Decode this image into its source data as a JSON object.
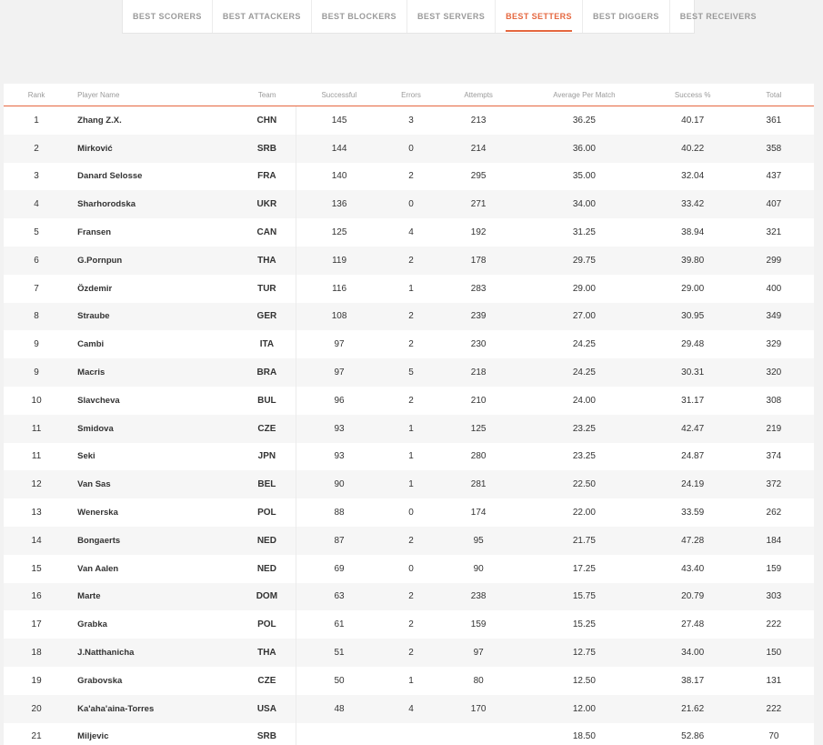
{
  "tabs": [
    {
      "label": "BEST SCORERS",
      "active": false
    },
    {
      "label": "BEST ATTACKERS",
      "active": false
    },
    {
      "label": "BEST BLOCKERS",
      "active": false
    },
    {
      "label": "BEST SERVERS",
      "active": false
    },
    {
      "label": "BEST SETTERS",
      "active": true
    },
    {
      "label": "BEST DIGGERS",
      "active": false
    },
    {
      "label": "BEST RECEIVERS",
      "active": false
    }
  ],
  "colors": {
    "accent": "#e5673f",
    "muted": "#9a9a9a",
    "row_alt": "#f6f6f6"
  },
  "table": {
    "columns": [
      "Rank",
      "Player Name",
      "Team",
      "Successful",
      "Errors",
      "Attempts",
      "Average Per Match",
      "Success %",
      "Total"
    ],
    "rows": [
      [
        "1",
        "Zhang Z.X.",
        "CHN",
        "145",
        "3",
        "213",
        "36.25",
        "40.17",
        "361"
      ],
      [
        "2",
        "Mirković",
        "SRB",
        "144",
        "0",
        "214",
        "36.00",
        "40.22",
        "358"
      ],
      [
        "3",
        "Danard Selosse",
        "FRA",
        "140",
        "2",
        "295",
        "35.00",
        "32.04",
        "437"
      ],
      [
        "4",
        "Sharhorodska",
        "UKR",
        "136",
        "0",
        "271",
        "34.00",
        "33.42",
        "407"
      ],
      [
        "5",
        "Fransen",
        "CAN",
        "125",
        "4",
        "192",
        "31.25",
        "38.94",
        "321"
      ],
      [
        "6",
        "G.Pornpun",
        "THA",
        "119",
        "2",
        "178",
        "29.75",
        "39.80",
        "299"
      ],
      [
        "7",
        "Özdemir",
        "TUR",
        "116",
        "1",
        "283",
        "29.00",
        "29.00",
        "400"
      ],
      [
        "8",
        "Straube",
        "GER",
        "108",
        "2",
        "239",
        "27.00",
        "30.95",
        "349"
      ],
      [
        "9",
        "Cambi",
        "ITA",
        "97",
        "2",
        "230",
        "24.25",
        "29.48",
        "329"
      ],
      [
        "9",
        "Macris",
        "BRA",
        "97",
        "5",
        "218",
        "24.25",
        "30.31",
        "320"
      ],
      [
        "10",
        "Slavcheva",
        "BUL",
        "96",
        "2",
        "210",
        "24.00",
        "31.17",
        "308"
      ],
      [
        "11",
        "Smidova",
        "CZE",
        "93",
        "1",
        "125",
        "23.25",
        "42.47",
        "219"
      ],
      [
        "11",
        "Seki",
        "JPN",
        "93",
        "1",
        "280",
        "23.25",
        "24.87",
        "374"
      ],
      [
        "12",
        "Van Sas",
        "BEL",
        "90",
        "1",
        "281",
        "22.50",
        "24.19",
        "372"
      ],
      [
        "13",
        "Wenerska",
        "POL",
        "88",
        "0",
        "174",
        "22.00",
        "33.59",
        "262"
      ],
      [
        "14",
        "Bongaerts",
        "NED",
        "87",
        "2",
        "95",
        "21.75",
        "47.28",
        "184"
      ],
      [
        "15",
        "Van Aalen",
        "NED",
        "69",
        "0",
        "90",
        "17.25",
        "43.40",
        "159"
      ],
      [
        "16",
        "Marte",
        "DOM",
        "63",
        "2",
        "238",
        "15.75",
        "20.79",
        "303"
      ],
      [
        "17",
        "Grabka",
        "POL",
        "61",
        "2",
        "159",
        "15.25",
        "27.48",
        "222"
      ],
      [
        "18",
        "J.Natthanicha",
        "THA",
        "51",
        "2",
        "97",
        "12.75",
        "34.00",
        "150"
      ],
      [
        "19",
        "Grabovska",
        "CZE",
        "50",
        "1",
        "80",
        "12.50",
        "38.17",
        "131"
      ],
      [
        "20",
        "Ka'aha'aina-Torres",
        "USA",
        "48",
        "4",
        "170",
        "12.00",
        "21.62",
        "222"
      ],
      [
        "21",
        "Miljevic",
        "SRB",
        "",
        "",
        "",
        "18.50",
        "52.86",
        "70"
      ]
    ]
  }
}
